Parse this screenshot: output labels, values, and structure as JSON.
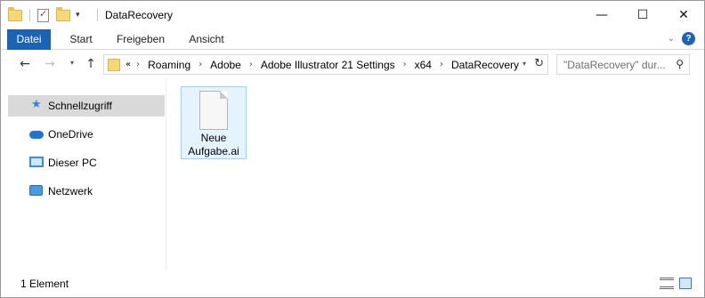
{
  "window": {
    "title": "DataRecovery"
  },
  "quick_access_toolbar": {
    "icons": [
      "folder-icon",
      "properties-icon",
      "new-folder-icon",
      "customize-dropdown-icon"
    ]
  },
  "window_controls": {
    "minimize": "—",
    "maximize": "☐",
    "close": "✕"
  },
  "ribbon": {
    "tabs": [
      {
        "label": "Datei",
        "active": true
      },
      {
        "label": "Start"
      },
      {
        "label": "Freigeben"
      },
      {
        "label": "Ansicht"
      }
    ],
    "expand_icon": "⌄",
    "help_icon": "?"
  },
  "navigation": {
    "back_icon": "←",
    "forward_icon": "→",
    "up_icon": "↑",
    "recent_dropdown_icon": "▾",
    "breadcrumb_overflow": "«",
    "breadcrumbs": [
      "Roaming",
      "Adobe",
      "Adobe Illustrator 21 Settings",
      "x64",
      "DataRecovery"
    ],
    "breadcrumb_separator": "›",
    "address_dropdown_icon": "▾",
    "refresh_icon": "↻"
  },
  "search": {
    "placeholder": "\"DataRecovery\" dur...",
    "icon": "⚲"
  },
  "sidebar": {
    "items": [
      {
        "label": "Schnellzugriff",
        "icon": "star-icon",
        "active": true
      },
      {
        "label": "OneDrive",
        "icon": "cloud-icon"
      },
      {
        "label": "Dieser PC",
        "icon": "monitor-icon"
      },
      {
        "label": "Netzwerk",
        "icon": "network-icon"
      }
    ]
  },
  "files": [
    {
      "name_line1": "Neue",
      "name_line2": "Aufgabe.ai",
      "icon": "document-icon",
      "selected": true
    }
  ],
  "statusbar": {
    "item_count": "1 Element"
  },
  "colors": {
    "accent": "#1a63b5",
    "selection_bg": "#e5f3ff",
    "selection_border": "#99d1ff",
    "sidebar_active": "#d9d9d9"
  }
}
